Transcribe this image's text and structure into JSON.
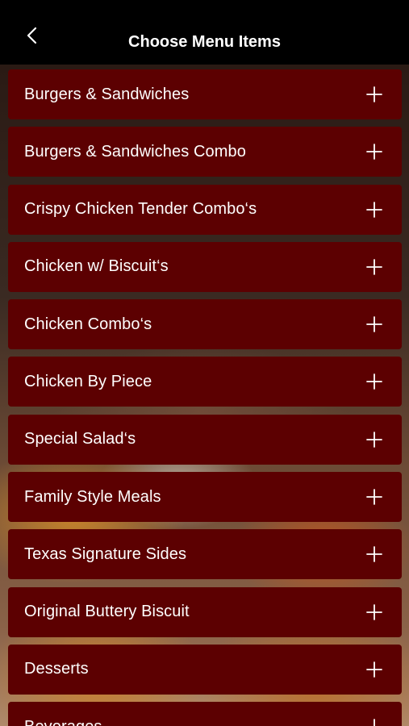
{
  "header": {
    "title": "Choose Menu Items",
    "back_icon": "chevron-left-icon"
  },
  "colors": {
    "header_bg": "#000000",
    "item_bg": "#5c0001",
    "text": "#ffffff"
  },
  "menu": {
    "items": [
      {
        "label": "Burgers & Sandwiches",
        "icon": "plus-icon"
      },
      {
        "label": "Burgers & Sandwiches Combo",
        "icon": "plus-icon"
      },
      {
        "label": "Crispy Chicken Tender Combo‘s",
        "icon": "plus-icon"
      },
      {
        "label": "Chicken w/ Biscuit‘s",
        "icon": "plus-icon"
      },
      {
        "label": "Chicken Combo‘s",
        "icon": "plus-icon"
      },
      {
        "label": "Chicken By Piece",
        "icon": "plus-icon"
      },
      {
        "label": "Special Salad‘s",
        "icon": "plus-icon"
      },
      {
        "label": "Family Style Meals",
        "icon": "plus-icon"
      },
      {
        "label": "Texas Signature Sides",
        "icon": "plus-icon"
      },
      {
        "label": "Original Buttery Biscuit",
        "icon": "plus-icon"
      },
      {
        "label": "Desserts",
        "icon": "plus-icon"
      },
      {
        "label": "Beverages",
        "icon": "plus-icon"
      }
    ]
  }
}
